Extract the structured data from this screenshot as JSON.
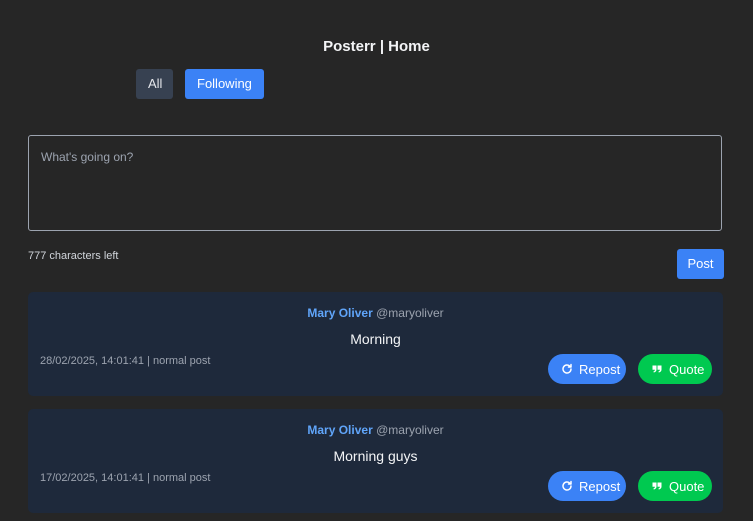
{
  "header": {
    "title": "Posterr | Home"
  },
  "tabs": [
    {
      "label": "All"
    },
    {
      "label": "Following"
    }
  ],
  "composer": {
    "placeholder": "What's going on?",
    "value": "",
    "chars_left": "777 characters left",
    "post_label": "Post"
  },
  "posts": [
    {
      "name": "Mary Oliver",
      "handle": "@maryoliver",
      "content": "Morning",
      "meta": "28/02/2025, 14:01:41 | normal post",
      "repost_label": "Repost",
      "quote_label": "Quote"
    },
    {
      "name": "Mary Oliver",
      "handle": "@maryoliver",
      "content": "Morning guys",
      "meta": "17/02/2025, 14:01:41 | normal post",
      "repost_label": "Repost",
      "quote_label": "Quote"
    }
  ],
  "colors": {
    "background": "#262626",
    "accent": "#3b82f6",
    "quote": "#00c950",
    "card": "#1e293b",
    "author": "#60a5fa"
  },
  "icons": {
    "repost": "repost-icon",
    "quote": "quote-icon"
  }
}
